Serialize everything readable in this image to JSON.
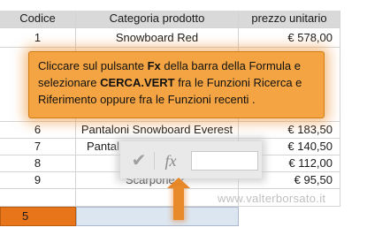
{
  "table": {
    "headers": {
      "code": "Codice",
      "category": "Categoria prodotto",
      "price": "prezzo unitario"
    },
    "rows": [
      {
        "code": "1",
        "category": "Snowboard Red",
        "price": "€ 578,00"
      },
      {
        "code": "6",
        "category": "Pantaloni Snowboard Everest",
        "price": "€ 183,50"
      },
      {
        "code": "7",
        "category": "Pantal",
        "price": "€ 140,50"
      },
      {
        "code": "8",
        "category": "",
        "price": "€ 112,00"
      },
      {
        "code": "9",
        "category": "Scarpone 2",
        "price": "€ 95,50"
      }
    ]
  },
  "callout": {
    "part1": "Cliccare sul pulsante ",
    "fx": "Fx",
    "part2": " della barra della Formula e selezionare ",
    "func": "CERCA.VERT",
    "part3": "  fra le Funzioni Ricerca e Riferimento oppure fra le Funzioni recenti ."
  },
  "formula_bar": {
    "check_symbol": "✔",
    "fx_symbol": "fx"
  },
  "watermark": "www.valterborsato.it",
  "input_cell": {
    "value": "5"
  },
  "colors": {
    "callout": "#f4a442",
    "arrow": "#e8892a",
    "input_cell": "#e8751a",
    "lookup_cell": "#dce6f1"
  }
}
